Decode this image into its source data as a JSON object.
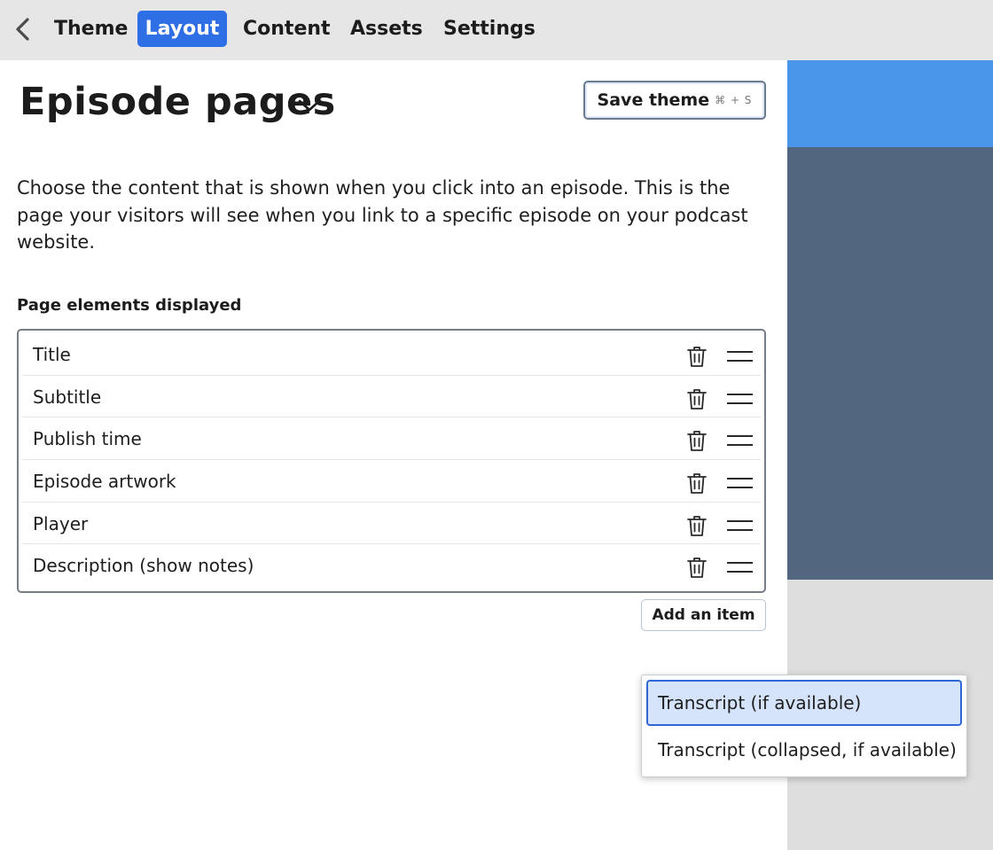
{
  "nav": {
    "back_icon": "chevron-left-icon",
    "tabs": [
      {
        "label": "Theme",
        "active": false
      },
      {
        "label": "Layout",
        "active": true
      },
      {
        "label": "Content",
        "active": false
      },
      {
        "label": "Assets",
        "active": false
      },
      {
        "label": "Settings",
        "active": false
      }
    ],
    "active_color": "#2f6fe6"
  },
  "header": {
    "title": "Episode pages",
    "title_icon": "chevron-down-icon",
    "save_label": "Save theme",
    "save_shortcut": "⌘ + S"
  },
  "description": "Choose the content that is shown when you click into an episode. This is the page your visitors will see when you link to a specific episode on your podcast website.",
  "elements": {
    "label": "Page elements displayed",
    "items": [
      {
        "label": "Title"
      },
      {
        "label": "Subtitle"
      },
      {
        "label": "Publish time"
      },
      {
        "label": "Episode artwork"
      },
      {
        "label": "Player"
      },
      {
        "label": "Description (show notes)"
      }
    ],
    "delete_icon": "trash-icon",
    "drag_icon": "drag-handle-icon",
    "add_label": "Add an item"
  },
  "dropdown": {
    "options": [
      {
        "label": "Transcript (if available)",
        "selected": true
      },
      {
        "label": "Transcript (collapsed, if available)",
        "selected": false
      }
    ],
    "selected_color": "#d6e4fb"
  },
  "preview": {
    "header_color": "#4a96ea",
    "body_color": "#52667f",
    "background_color": "#dedede"
  }
}
